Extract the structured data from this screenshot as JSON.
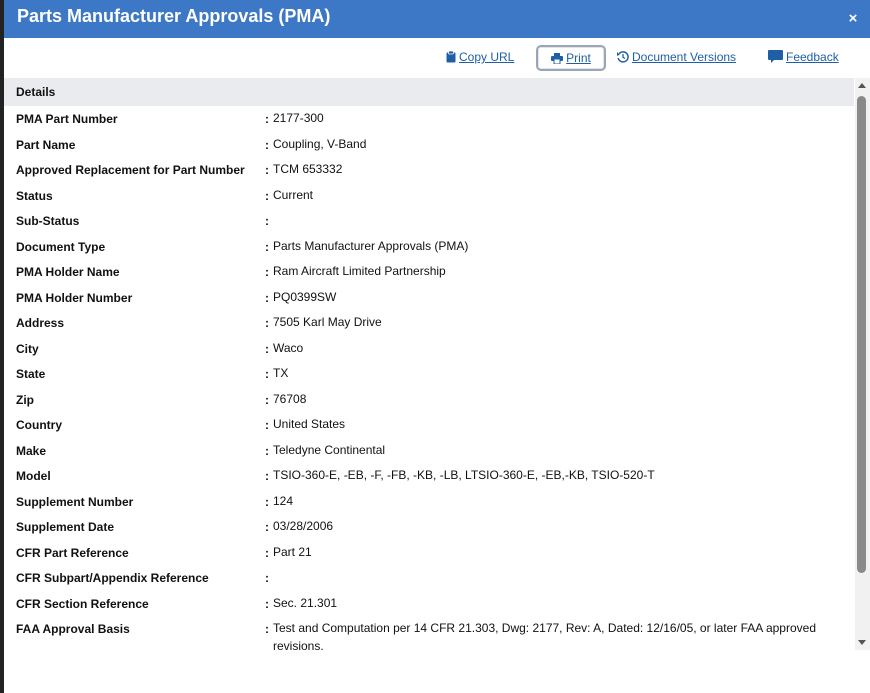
{
  "header": {
    "title": "Parts Manufacturer Approvals (PMA)",
    "close_label": "×"
  },
  "toolbar": {
    "copy_url": "Copy URL",
    "print": "Print",
    "document_versions": "Document Versions",
    "feedback": "Feedback"
  },
  "section": {
    "title": "Details"
  },
  "colors": {
    "header_bg": "#3d78c6",
    "link": "#1f5fa8",
    "section_bg": "#e9ebee"
  },
  "details": [
    {
      "label": "PMA Part Number",
      "value": "2177-300"
    },
    {
      "label": "Part Name",
      "value": "Coupling, V-Band"
    },
    {
      "label": "Approved Replacement for Part Number",
      "value": "TCM 653332"
    },
    {
      "label": "Status",
      "value": "Current"
    },
    {
      "label": "Sub-Status",
      "value": ""
    },
    {
      "label": "Document Type",
      "value": "Parts Manufacturer Approvals (PMA)"
    },
    {
      "label": "PMA Holder Name",
      "value": "Ram Aircraft Limited Partnership"
    },
    {
      "label": "PMA Holder Number",
      "value": "PQ0399SW"
    },
    {
      "label": "Address",
      "value": "7505 Karl May Drive"
    },
    {
      "label": "City",
      "value": "Waco"
    },
    {
      "label": "State",
      "value": "TX"
    },
    {
      "label": "Zip",
      "value": "76708"
    },
    {
      "label": "Country",
      "value": "United States"
    },
    {
      "label": "Make",
      "value": "Teledyne Continental"
    },
    {
      "label": "Model",
      "value": "TSIO-360-E, -EB, -F, -FB, -KB, -LB, LTSIO-360-E, -EB,-KB, TSIO-520-T"
    },
    {
      "label": "Supplement Number",
      "value": "124"
    },
    {
      "label": "Supplement Date",
      "value": "03/28/2006"
    },
    {
      "label": "CFR Part Reference",
      "value": "Part 21"
    },
    {
      "label": "CFR Subpart/Appendix Reference",
      "value": ""
    },
    {
      "label": "CFR Section Reference",
      "value": "Sec. 21.301"
    },
    {
      "label": "FAA Approval Basis",
      "value": "Test and Computation per 14 CFR 21.303, Dwg: 2177, Rev: A, Dated: 12/16/05, or later FAA approved revisions."
    }
  ]
}
